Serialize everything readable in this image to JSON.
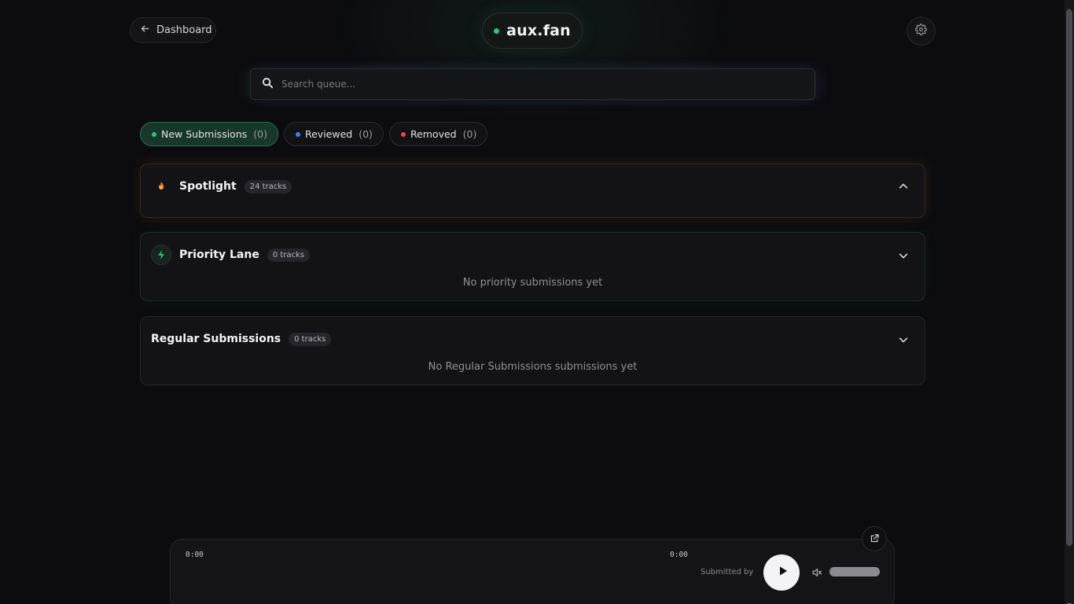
{
  "header": {
    "back_label": "Dashboard",
    "logo_text": "aux.fan",
    "logo_dot_color": "#2fc27f"
  },
  "search": {
    "placeholder": "Search queue...",
    "value": ""
  },
  "tabs": [
    {
      "label": "New Submissions",
      "count": "(0)",
      "dot_color": "#2fc27f",
      "active": true
    },
    {
      "label": "Reviewed",
      "count": "(0)",
      "dot_color": "#3b82f6",
      "active": false
    },
    {
      "label": "Removed",
      "count": "(0)",
      "dot_color": "#ef4444",
      "active": false
    }
  ],
  "sections": {
    "spotlight": {
      "title": "Spotlight",
      "badge": "24 tracks",
      "icon": "flame-icon",
      "expanded": true
    },
    "priority": {
      "title": "Priority Lane",
      "badge": "0 tracks",
      "icon": "bolt-icon",
      "empty": "No priority submissions yet"
    },
    "regular": {
      "title": "Regular Submissions",
      "badge": "0 tracks",
      "empty": "No Regular Submissions submissions yet"
    }
  },
  "player": {
    "current_time": "0:00",
    "duration": "0:00",
    "submitted_by": "Submitted by",
    "volume": 1.0
  },
  "icons": {
    "back": "arrow-left-icon",
    "settings": "gear-icon",
    "search": "search-icon",
    "chevron_up": "chevron-up-icon",
    "chevron_down": "chevron-down-icon",
    "play": "play-icon",
    "volume": "speaker-icon",
    "external": "external-link-icon"
  }
}
